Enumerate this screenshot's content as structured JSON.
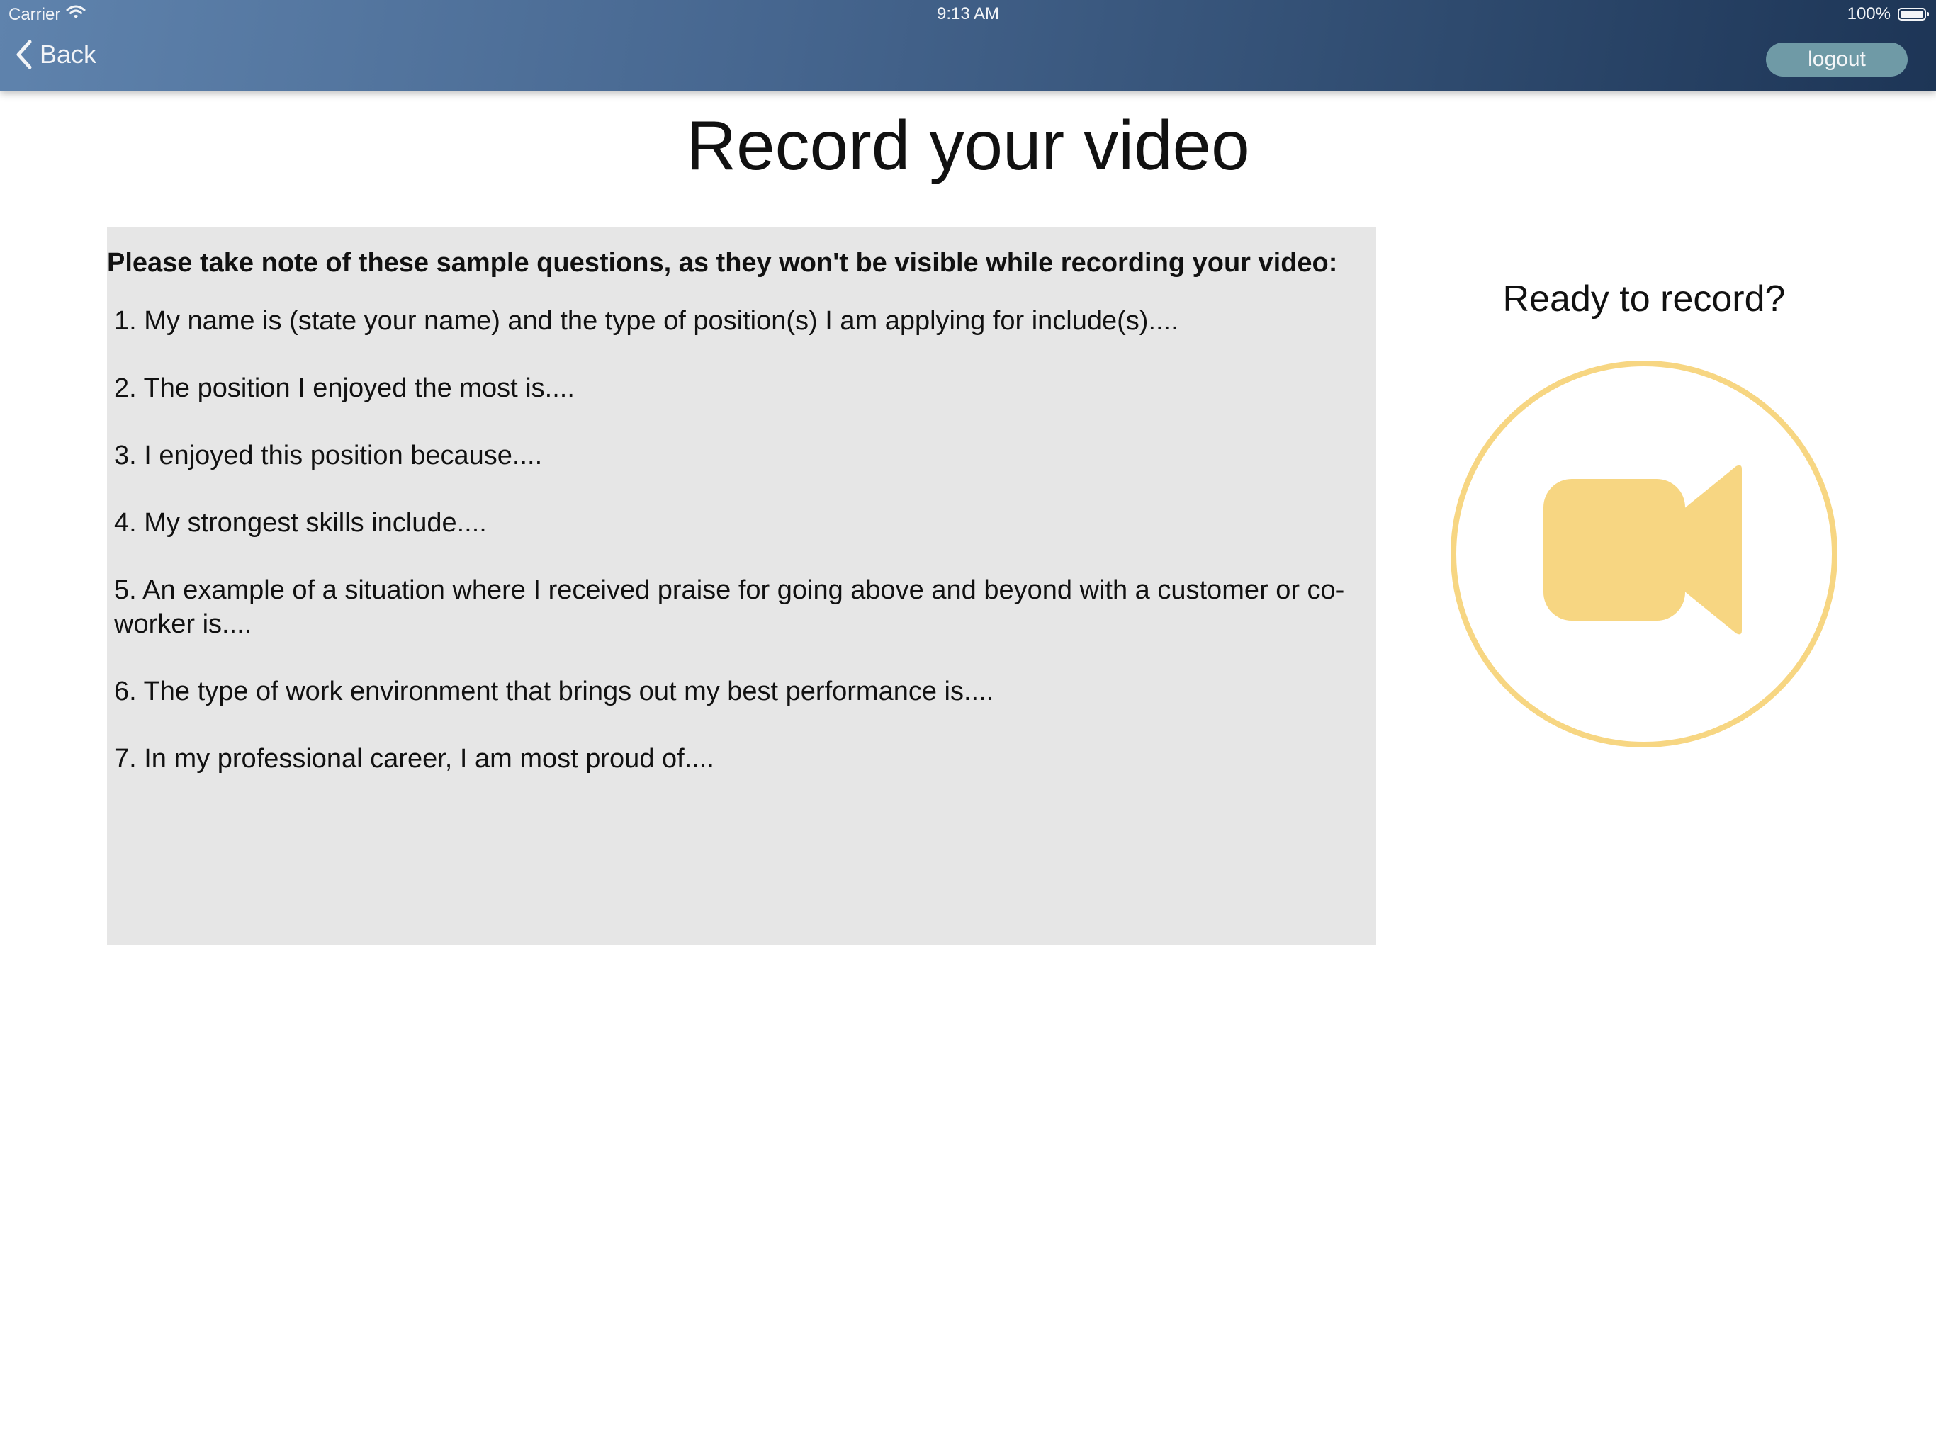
{
  "status_bar": {
    "carrier": "Carrier",
    "time": "9:13 AM",
    "battery": "100%"
  },
  "nav": {
    "back_label": "Back",
    "logout_label": "logout"
  },
  "page": {
    "title": "Record your video"
  },
  "questions": {
    "heading": "Please take note of these sample questions, as they won't be visible while recording your video:",
    "items": [
      "1. My name is (state your name) and the type of position(s) I am applying for include(s)....",
      "2. The position I enjoyed the most is....",
      "3. I enjoyed this position because....",
      "4. My strongest skills include....",
      "5. An example of a situation where I received praise for going above and beyond with a customer or co-worker is....",
      "6. The type of work environment that brings out my best performance is....",
      "7. In my professional career, I am most proud of...."
    ]
  },
  "record": {
    "prompt": "Ready to record?",
    "icon": "video-camera-icon",
    "accent_color": "#f7d682"
  },
  "colors": {
    "nav_gradient_start": "#5f83ad",
    "nav_gradient_end": "#1d3556",
    "logout_bg": "#6f9aa6",
    "panel_bg": "#e6e6e6"
  }
}
